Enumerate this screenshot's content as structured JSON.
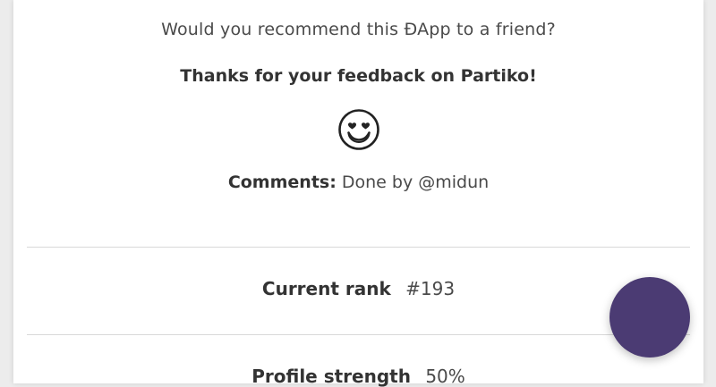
{
  "feedback": {
    "question": "Would you recommend this ÐApp to a friend?",
    "thanks": "Thanks for your feedback on Partiko!",
    "reaction_icon": "heart-eyes-smile-icon",
    "comments_label": "Comments:",
    "comments_value": "Done by @midun"
  },
  "stats": [
    {
      "label": "Current rank",
      "value": "#193"
    },
    {
      "label": "Profile strength",
      "value": "50%"
    }
  ],
  "chat": {
    "icon": "chat-launcher-icon",
    "color": "#4b3b73"
  }
}
